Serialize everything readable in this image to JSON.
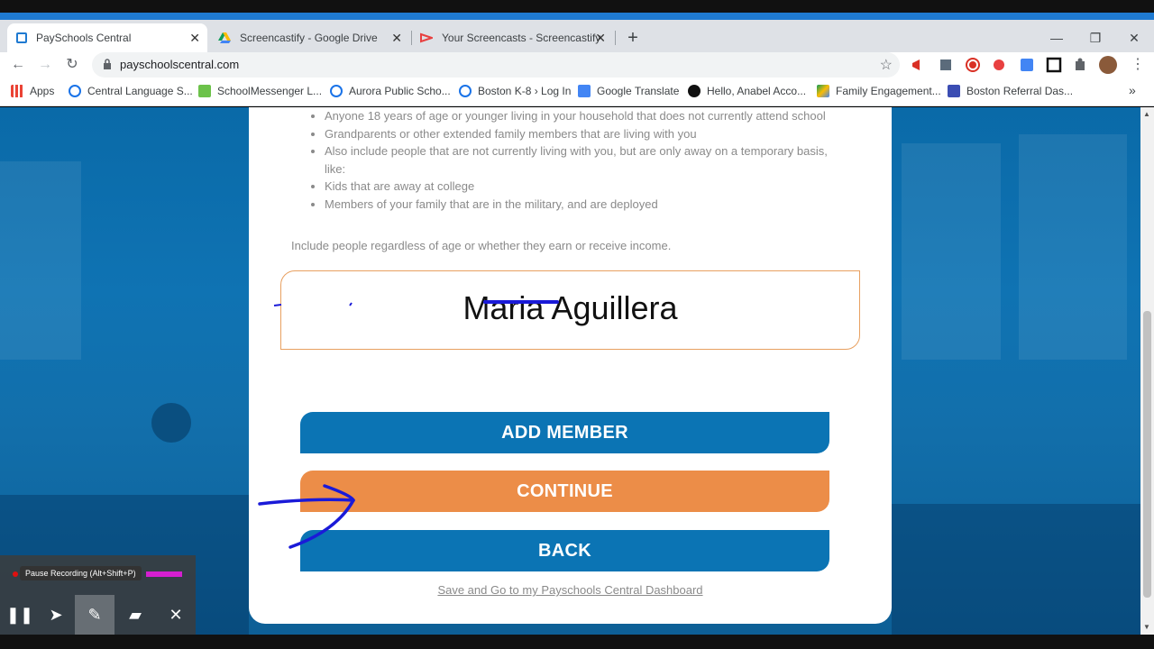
{
  "browser": {
    "tabs": [
      {
        "title": "PaySchools Central",
        "active": true
      },
      {
        "title": "Screencastify - Google Drive",
        "active": false
      },
      {
        "title": "Your Screencasts - Screencastify",
        "active": false
      }
    ],
    "url": "payschoolscentral.com",
    "bookmarks": [
      "Apps",
      "Central Language S...",
      "SchoolMessenger L...",
      "Aurora Public Scho...",
      "Boston K-8 › Log In",
      "Google Translate",
      "Hello, Anabel Acco...",
      "Family Engagement...",
      "Boston Referral Das..."
    ]
  },
  "page": {
    "list_items": [
      "Anyone 18 years of age or younger living in your household that does not currently attend school",
      "Grandparents or other extended family members that are living with you",
      "Also include people that are not currently living with you, but are only away on a temporary basis, like:",
      "Kids that are away at college",
      "Members of your family that are in the military, and are deployed"
    ],
    "note": "Include people regardless of age or whether they earn or receive income.",
    "member_name": "Maria Aguillera",
    "add_member_label": "ADD MEMBER",
    "continue_label": "CONTINUE",
    "back_label": "BACK",
    "dashboard_link": "Save and Go to my Payschools Central Dashboard"
  },
  "recorder": {
    "tooltip": "Pause Recording (Alt+Shift+P)"
  },
  "colors": {
    "primary_blue": "#0b74b4",
    "orange": "#ec8d48",
    "annotation": "#1a1ad8"
  }
}
